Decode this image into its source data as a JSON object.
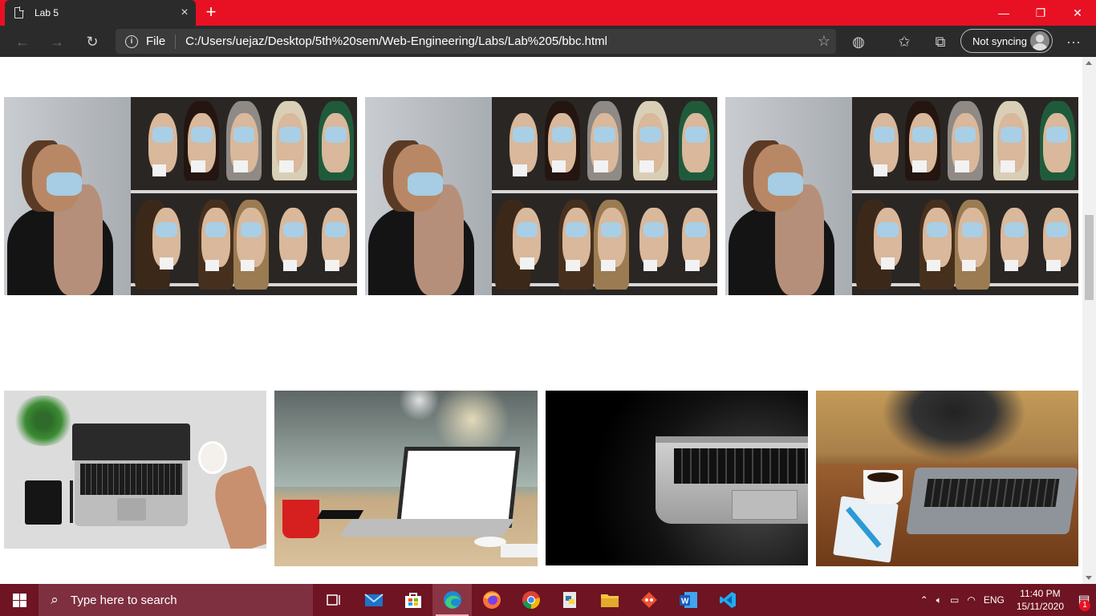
{
  "browser": {
    "tab": {
      "title": "Lab 5",
      "close_icon": "×"
    },
    "new_tab_icon": "+",
    "window_controls": {
      "minimize": "—",
      "maximize": "❐",
      "close": "✕"
    },
    "address": {
      "scheme_label": "File",
      "url": "C:/Users/uejaz/Desktop/5th%20sem/Web-Engineering/Labs/Lab%205/bbc.html"
    },
    "profile": {
      "label": "Not syncing"
    }
  },
  "page": {
    "gallery_row_1": [
      {
        "name": "masked-mannequins-photo-1"
      },
      {
        "name": "masked-mannequins-photo-2"
      },
      {
        "name": "masked-mannequins-photo-3"
      }
    ],
    "gallery_row_2": [
      {
        "name": "laptop-top-view-photo"
      },
      {
        "name": "laptop-desk-photo"
      },
      {
        "name": "laptop-dark-photo"
      },
      {
        "name": "laptop-cafe-photo"
      }
    ]
  },
  "taskbar": {
    "search_placeholder": "Type here to search",
    "apps": [
      "task-view",
      "mail",
      "store",
      "edge",
      "firefox",
      "chrome",
      "python",
      "file-explorer",
      "git",
      "word",
      "vscode"
    ],
    "language": "ENG",
    "time": "11:40 PM",
    "date": "15/11/2020",
    "notification_count": "1"
  }
}
